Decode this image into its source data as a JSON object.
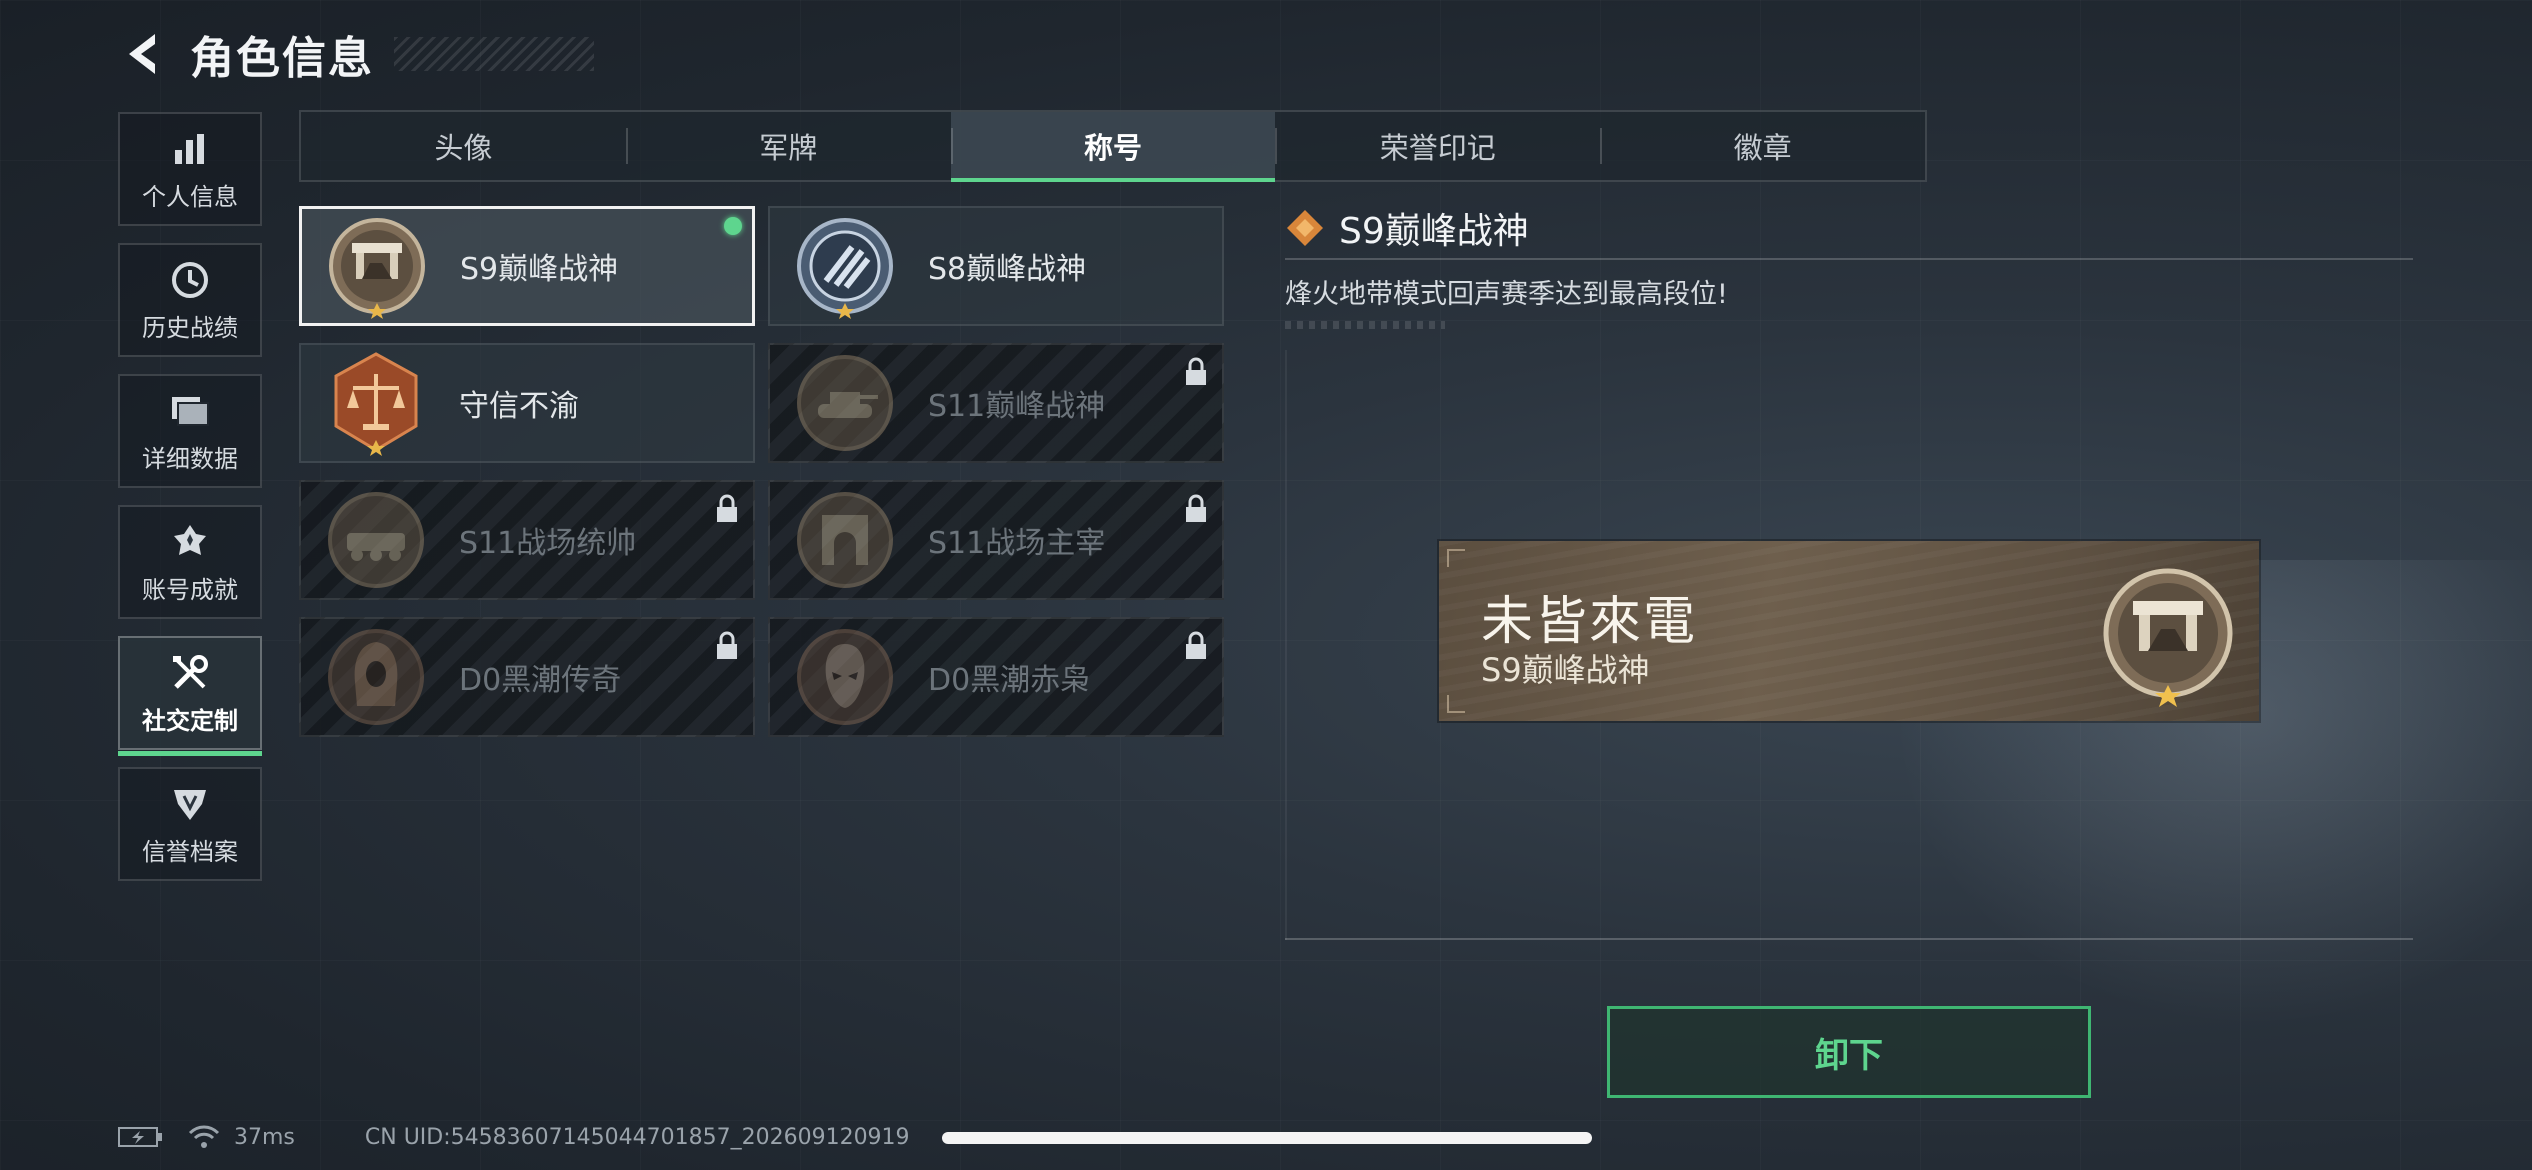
{
  "header": {
    "title": "角色信息"
  },
  "sidebar": {
    "items": [
      {
        "label": "个人信息",
        "icon": "bar-chart-icon"
      },
      {
        "label": "历史战绩",
        "icon": "clock-icon"
      },
      {
        "label": "详细数据",
        "icon": "folder-icon"
      },
      {
        "label": "账号成就",
        "icon": "achievement-icon"
      },
      {
        "label": "社交定制",
        "icon": "tools-icon",
        "active": true
      },
      {
        "label": "信誉档案",
        "icon": "emblem-icon"
      }
    ]
  },
  "tabs": [
    {
      "label": "头像"
    },
    {
      "label": "军牌"
    },
    {
      "label": "称号",
      "active": true
    },
    {
      "label": "荣誉印记"
    },
    {
      "label": "徽章"
    }
  ],
  "titles": [
    {
      "name": "S9巅峰战神",
      "state": "equipped-selected",
      "icon": "monument-medal-icon"
    },
    {
      "name": "S8巅峰战神",
      "state": "owned",
      "icon": "blue-crest-medal-icon"
    },
    {
      "name": "守信不渝",
      "state": "owned",
      "icon": "scales-medal-icon"
    },
    {
      "name": "S11巅峰战神",
      "state": "locked",
      "icon": "tank-medal-icon"
    },
    {
      "name": "S11战场统帅",
      "state": "locked",
      "icon": "apc-medal-icon"
    },
    {
      "name": "S11战场主宰",
      "state": "locked",
      "icon": "arch-medal-icon"
    },
    {
      "name": "D0黑潮传奇",
      "state": "locked",
      "icon": "hooded-figure-medal-icon"
    },
    {
      "name": "D0黑潮赤枭",
      "state": "locked",
      "icon": "skull-mask-medal-icon"
    }
  ],
  "detail": {
    "title": "S9巅峰战神",
    "description": "烽火地带模式回声赛季达到最高段位!"
  },
  "preview": {
    "player_name": "未皆來電",
    "title": "S9巅峰战神"
  },
  "actions": {
    "unequip_label": "卸下"
  },
  "status_bar": {
    "ping": "37ms",
    "uid": "CN UID:545836071450447018​57_202609120919"
  },
  "colors": {
    "accent": "#5ed58e",
    "bronze": "#8a7660",
    "plate": "#6e5f4d"
  }
}
